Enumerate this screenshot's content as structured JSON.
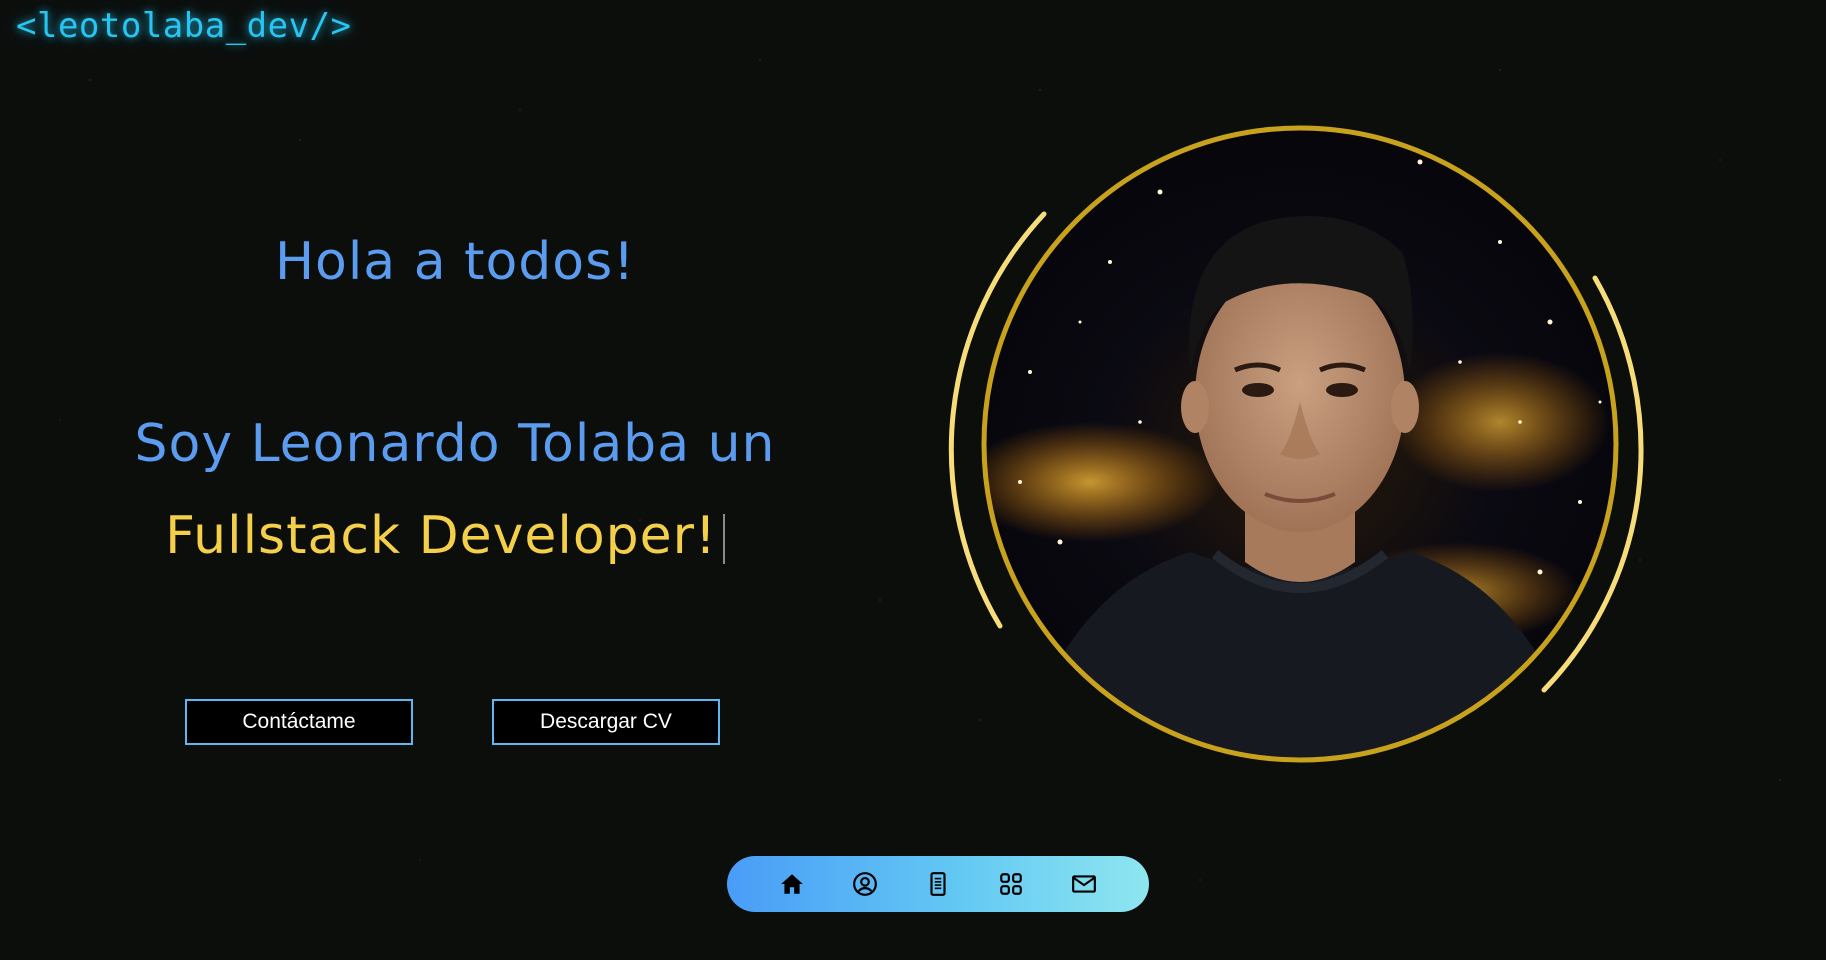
{
  "header": {
    "logo_text": "<leotolaba_dev/>"
  },
  "hero": {
    "greeting": "Hola a todos!",
    "intro": "Soy Leonardo Tolaba un",
    "role": "Fullstack Developer!"
  },
  "actions": {
    "contact_label": "Contáctame",
    "cv_label": "Descargar CV"
  },
  "profile": {
    "ring_color": "#c9a21d",
    "arc_color": "#f6dd7a"
  },
  "dock": {
    "items": [
      {
        "icon": "home-icon"
      },
      {
        "icon": "user-circle-icon"
      },
      {
        "icon": "document-icon"
      },
      {
        "icon": "grid-icon"
      },
      {
        "icon": "mail-icon"
      }
    ],
    "gradient": [
      "#4a9cf7",
      "#8ee6ef"
    ]
  },
  "colors": {
    "logo": "#27c6f2",
    "primary_text": "#5b9cf0",
    "accent_text": "#f3cf4a",
    "button_border": "#61b6f2",
    "background": "#0c0e0c"
  }
}
